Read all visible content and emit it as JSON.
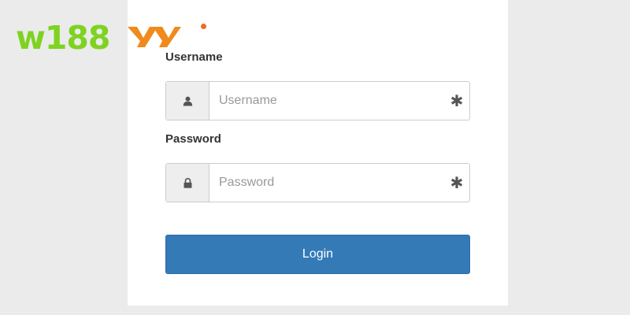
{
  "brand": {
    "name": "w188",
    "name_color": "#7ed321",
    "mark_color": "#f08a1c",
    "dot_color": "#ef6a26"
  },
  "form": {
    "username_label": "Username",
    "username_placeholder": "Username",
    "username_icon": "user-icon",
    "password_label": "Password",
    "password_placeholder": "Password",
    "password_icon": "lock-icon",
    "required_marker": "✱",
    "login_label": "Login"
  },
  "colors": {
    "page_background": "#ebebeb",
    "panel_background": "#ffffff",
    "button": "#337ab7"
  }
}
